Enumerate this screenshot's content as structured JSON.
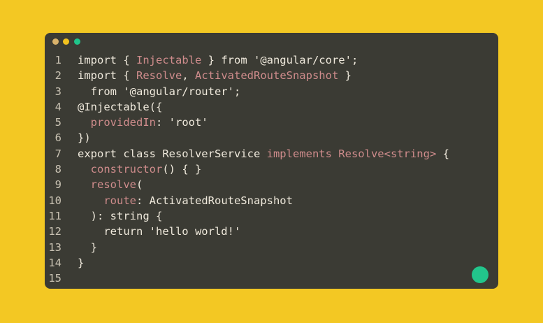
{
  "window": {
    "traffic_lights": [
      "close",
      "minimize",
      "maximize"
    ]
  },
  "code_lines": [
    {
      "n": "1",
      "segments": [
        {
          "t": "import { ",
          "c": "kw"
        },
        {
          "t": "Injectable",
          "c": "ty"
        },
        {
          "t": " } from '@angular/core';",
          "c": "kw"
        }
      ]
    },
    {
      "n": "2",
      "segments": [
        {
          "t": "import { ",
          "c": "kw"
        },
        {
          "t": "Resolve",
          "c": "ty"
        },
        {
          "t": ", ",
          "c": "kw"
        },
        {
          "t": "ActivatedRouteSnapshot",
          "c": "ty"
        },
        {
          "t": " }",
          "c": "kw"
        }
      ]
    },
    {
      "n": "3",
      "segments": [
        {
          "t": "  from '@angular/router';",
          "c": "kw"
        }
      ]
    },
    {
      "n": "4",
      "segments": [
        {
          "t": "@Injectable({",
          "c": "kw"
        }
      ]
    },
    {
      "n": "5",
      "segments": [
        {
          "t": "  ",
          "c": "kw"
        },
        {
          "t": "providedIn",
          "c": "prop"
        },
        {
          "t": ": 'root'",
          "c": "kw"
        }
      ]
    },
    {
      "n": "6",
      "segments": [
        {
          "t": "})",
          "c": "kw"
        }
      ]
    },
    {
      "n": "7",
      "segments": [
        {
          "t": "export class ResolverService ",
          "c": "kw"
        },
        {
          "t": "implements",
          "c": "prop"
        },
        {
          "t": " ",
          "c": "kw"
        },
        {
          "t": "Resolve<string>",
          "c": "ty"
        },
        {
          "t": " {",
          "c": "kw"
        }
      ]
    },
    {
      "n": "8",
      "segments": [
        {
          "t": "  ",
          "c": "kw"
        },
        {
          "t": "constructor",
          "c": "fn"
        },
        {
          "t": "() { }",
          "c": "kw"
        }
      ]
    },
    {
      "n": "9",
      "segments": [
        {
          "t": "  ",
          "c": "kw"
        },
        {
          "t": "resolve",
          "c": "fn"
        },
        {
          "t": "(",
          "c": "kw"
        }
      ]
    },
    {
      "n": "10",
      "segments": [
        {
          "t": "    ",
          "c": "kw"
        },
        {
          "t": "route",
          "c": "prop"
        },
        {
          "t": ": ActivatedRouteSnapshot",
          "c": "kw"
        }
      ]
    },
    {
      "n": "11",
      "segments": [
        {
          "t": "  ): string {",
          "c": "kw"
        }
      ]
    },
    {
      "n": "12",
      "segments": [
        {
          "t": "    return 'hello world!'",
          "c": "kw"
        }
      ]
    },
    {
      "n": "13",
      "segments": [
        {
          "t": "  }",
          "c": "kw"
        }
      ]
    },
    {
      "n": "14",
      "segments": [
        {
          "t": "}",
          "c": "kw"
        }
      ]
    },
    {
      "n": "15",
      "segments": []
    }
  ],
  "colors": {
    "background": "#f3c823",
    "editor": "#3b3b34",
    "text": "#efe9dc",
    "accent_pink": "#cf8c8c",
    "fab": "#22c58b"
  }
}
